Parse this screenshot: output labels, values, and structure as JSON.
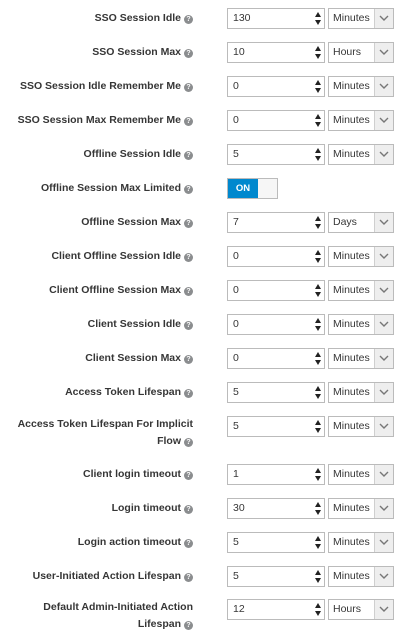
{
  "settings": [
    {
      "label": "SSO Session Idle",
      "value": "130",
      "unit": "Minutes"
    },
    {
      "label": "SSO Session Max",
      "value": "10",
      "unit": "Hours"
    },
    {
      "label": "SSO Session Idle Remember Me",
      "value": "0",
      "unit": "Minutes"
    },
    {
      "label": "SSO Session Max Remember Me",
      "value": "0",
      "unit": "Minutes"
    },
    {
      "label": "Offline Session Idle",
      "value": "5",
      "unit": "Minutes"
    },
    {
      "label": "Offline Session Max Limited",
      "toggle": "ON"
    },
    {
      "label": "Offline Session Max",
      "value": "7",
      "unit": "Days"
    },
    {
      "label": "Client Offline Session Idle",
      "value": "0",
      "unit": "Minutes"
    },
    {
      "label": "Client Offline Session Max",
      "value": "0",
      "unit": "Minutes"
    },
    {
      "label": "Client Session Idle",
      "value": "0",
      "unit": "Minutes"
    },
    {
      "label": "Client Session Max",
      "value": "0",
      "unit": "Minutes"
    },
    {
      "label": "Access Token Lifespan",
      "value": "5",
      "unit": "Minutes"
    },
    {
      "label": "Access Token Lifespan For Implicit Flow",
      "value": "5",
      "unit": "Minutes"
    },
    {
      "label": "Client login timeout",
      "value": "1",
      "unit": "Minutes"
    },
    {
      "label": "Login timeout",
      "value": "30",
      "unit": "Minutes"
    },
    {
      "label": "Login action timeout",
      "value": "5",
      "unit": "Minutes"
    },
    {
      "label": "User-Initiated Action Lifespan",
      "value": "5",
      "unit": "Minutes"
    },
    {
      "label": "Default Admin-Initiated Action Lifespan",
      "value": "12",
      "unit": "Hours"
    }
  ],
  "icons": {
    "help": "question-circle-icon",
    "spinner": "spinner-arrows-icon",
    "dropdown": "chevron-down-icon"
  },
  "colors": {
    "toggle_on": "#0088ce",
    "label_text": "#363636"
  }
}
